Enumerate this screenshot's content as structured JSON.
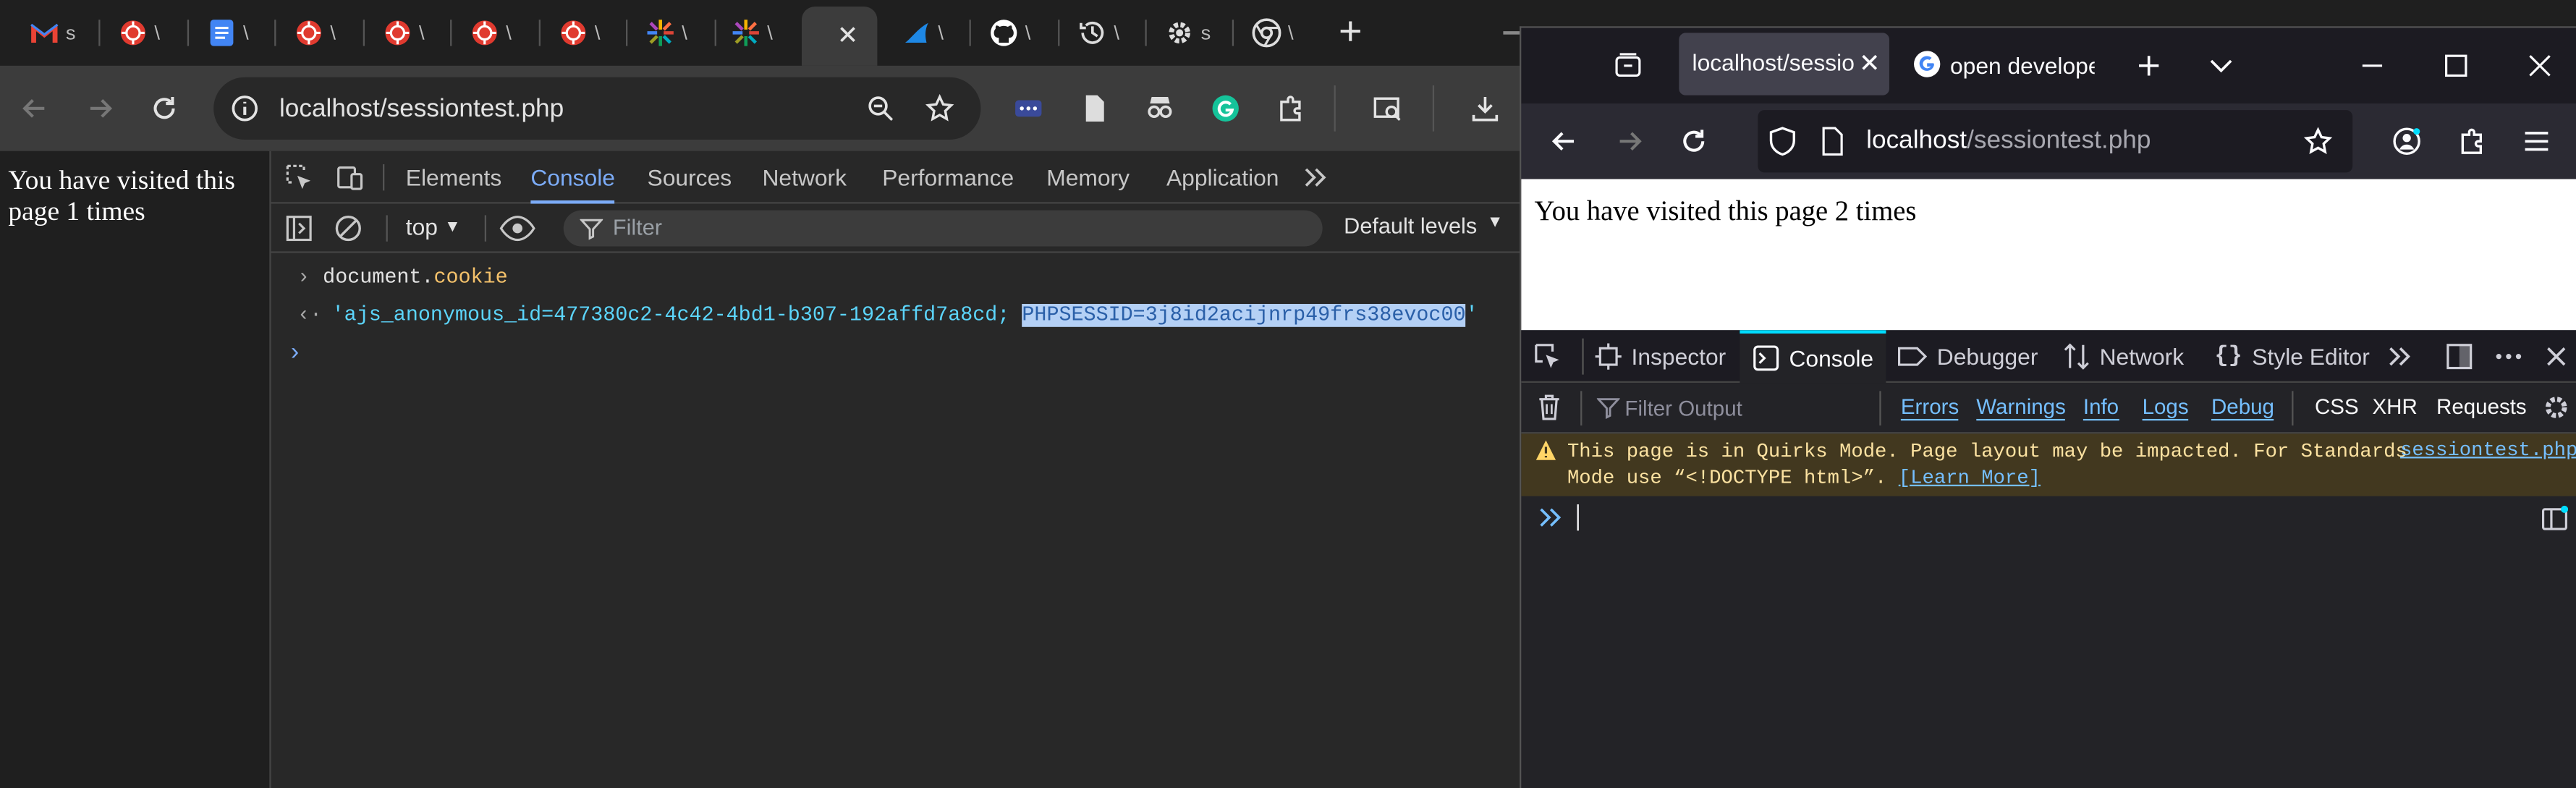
{
  "chrome": {
    "address": "localhost/sessiontest.php",
    "tab_trunc_labels": [
      "s",
      "\\",
      "\\",
      "\\",
      "\\",
      "\\",
      "\\",
      "\\",
      "\\",
      "\\",
      "\\",
      "\\",
      "\\",
      "\\",
      "s",
      "\\"
    ],
    "page_text": "You have visited this page 1 times",
    "devtools": {
      "tabs": [
        "Elements",
        "Console",
        "Sources",
        "Network",
        "Performance",
        "Memory",
        "Application"
      ],
      "context": "top",
      "filter_placeholder": "Filter",
      "levels": "Default levels",
      "input": "document.",
      "input_prop": "cookie",
      "output_pre": "'ajs_anonymous_id=477380c2-4c42-4bd1-b307-192affd7a8cd; ",
      "output_sel": "PHPSESSID=3j8id2acijnrp49frs38evoc00",
      "output_post": "'"
    }
  },
  "firefox": {
    "tab1": "localhost/sessio",
    "tab2": "open develope",
    "address_host": "localhost",
    "address_path": "/sessiontest.php",
    "page_text": "You have visited this page 2 times",
    "devtools": {
      "tabs": [
        "Inspector",
        "Console",
        "Debugger",
        "Network",
        "Style Editor"
      ],
      "filter_placeholder": "Filter Output",
      "levels": [
        "Errors",
        "Warnings",
        "Info",
        "Logs",
        "Debug"
      ],
      "extra": [
        "CSS",
        "XHR",
        "Requests"
      ],
      "warning_line1": "This page is in Quirks Mode. Page layout may be impacted. For Standards",
      "warning_line2": "Mode use “<!DOCTYPE html>”.",
      "learn_more": "[Learn More]",
      "source": "sessiontest.php"
    }
  },
  "colors": {
    "chrome_accent": "#7cacf8",
    "firefox_accent": "#75bfff",
    "warning_bg": "#42381f"
  }
}
